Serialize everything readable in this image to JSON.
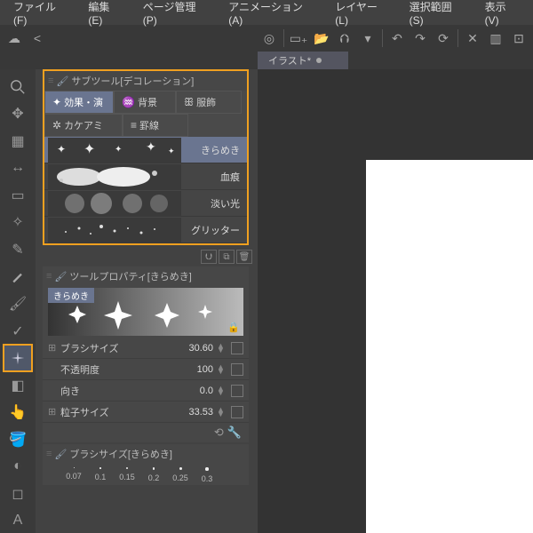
{
  "menu": {
    "file": "ファイル(F)",
    "edit": "編集(E)",
    "page": "ページ管理(P)",
    "anim": "アニメーション(A)",
    "layer": "レイヤー(L)",
    "select": "選択範囲(S)",
    "view": "表示(V)"
  },
  "tab": {
    "label": "イラスト*"
  },
  "subtool": {
    "title": "サブツール[デコレーション]",
    "cats": {
      "effect": "効果・演",
      "bg": "背景",
      "cloth": "服飾",
      "hatch": "カケアミ",
      "rule": "罫線"
    },
    "items": {
      "kirameki": "きらめき",
      "blood": "血痕",
      "softlight": "淡い光",
      "glitter": "グリッター"
    }
  },
  "prop": {
    "title": "ツールプロパティ[きらめき]",
    "badge": "きらめき",
    "rows": {
      "brush": "ブラシサイズ",
      "brush_v": "30.60",
      "opac": "不透明度",
      "opac_v": "100",
      "dir": "向き",
      "dir_v": "0.0",
      "part": "粒子サイズ",
      "part_v": "33.53"
    }
  },
  "bsize": {
    "title": "ブラシサイズ[きらめき]",
    "vals": [
      "0.07",
      "0.1",
      "0.15",
      "0.2",
      "0.25",
      "0.3"
    ]
  }
}
